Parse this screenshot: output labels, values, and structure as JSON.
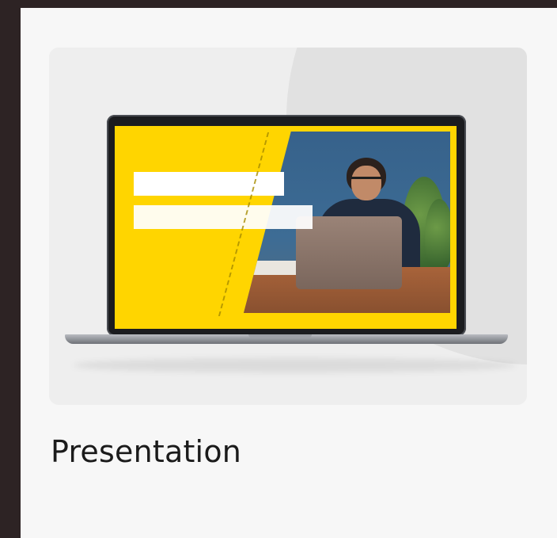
{
  "template_card": {
    "title": "Presentation",
    "thumbnail_icon": "laptop-presentation-thumbnail-icon"
  },
  "colors": {
    "outer_frame": "#2d2324",
    "panel": "#f7f7f7",
    "card": "#eeeeee",
    "screen_accent": "#ffd500"
  }
}
